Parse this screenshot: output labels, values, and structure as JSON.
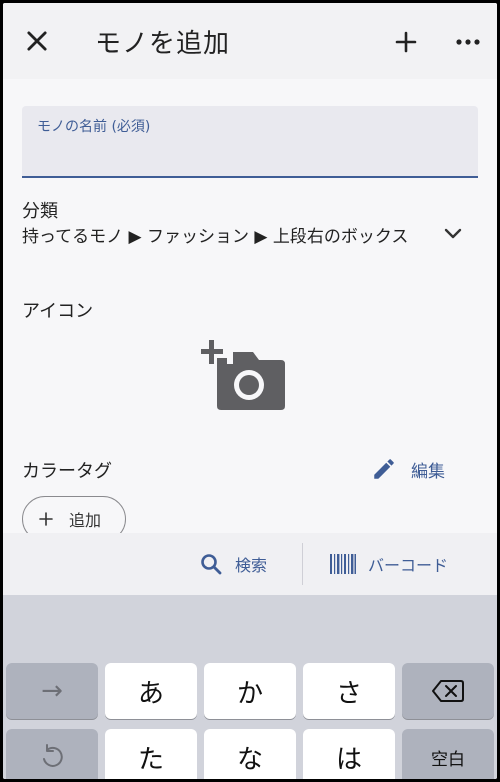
{
  "appbar": {
    "title": "モノを追加"
  },
  "form": {
    "name_label": "モノの名前 (必須)",
    "name_value": "",
    "category_label": "分類",
    "category_path": "持ってるモノ ▶ ファッション ▶ 上段右のボックス",
    "icon_label": "アイコン",
    "color_tag_label": "カラータグ",
    "edit_label": "編集",
    "add_chip_label": "追加"
  },
  "searchbar": {
    "search_label": "検索",
    "barcode_label": "バーコード"
  },
  "keyboard": {
    "row1": [
      "→",
      "あ",
      "か",
      "さ",
      "⌫"
    ],
    "row2": [
      "↺",
      "た",
      "な",
      "は",
      "空白"
    ]
  },
  "colors": {
    "accent": "#3f5d96",
    "icon_gray": "#5f5f62",
    "keyboard_bg": "#d1d3db"
  }
}
